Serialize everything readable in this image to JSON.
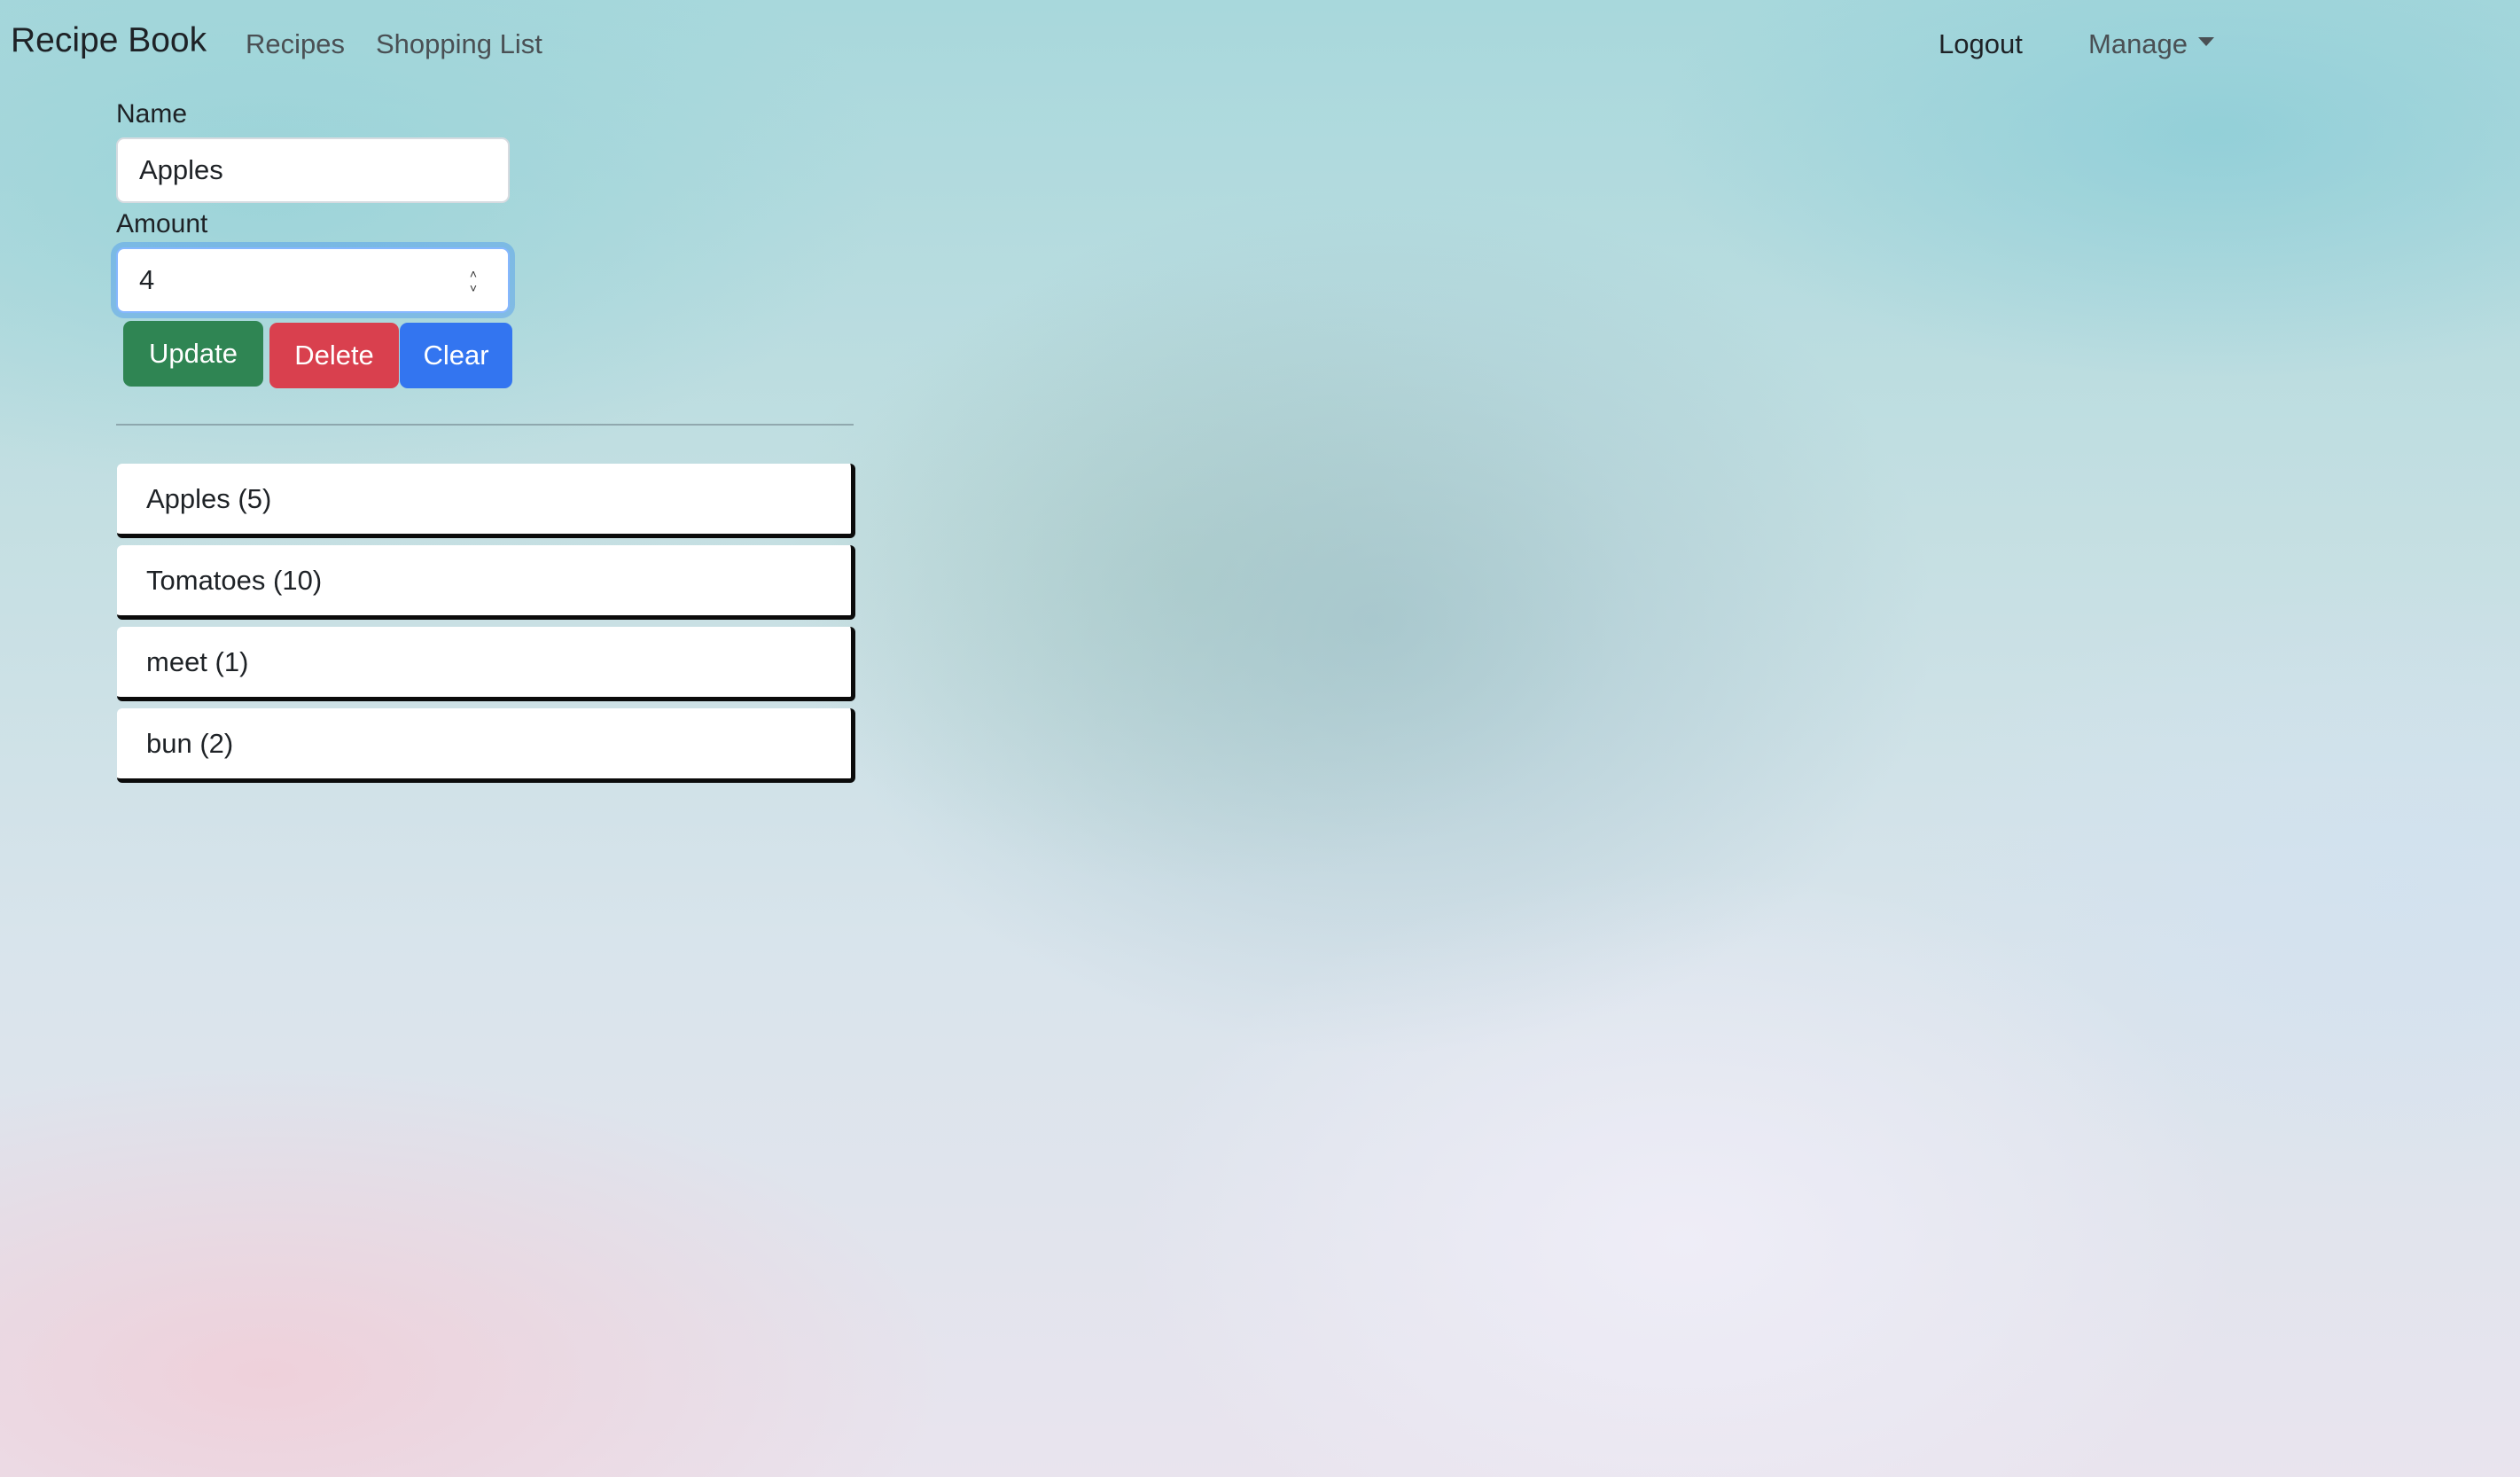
{
  "navbar": {
    "brand": "Recipe Book",
    "links": {
      "recipes": "Recipes",
      "shopping_list": "Shopping List",
      "logout": "Logout",
      "manage": "Manage"
    }
  },
  "form": {
    "name_label": "Name",
    "name_value": "Apples",
    "amount_label": "Amount",
    "amount_value": "4",
    "buttons": {
      "update": "Update",
      "delete": "Delete",
      "clear": "Clear"
    },
    "button_colors": {
      "update": "#2f8553",
      "delete": "#d9404e",
      "clear": "#3375f0"
    }
  },
  "shopping_list": {
    "items": [
      {
        "label": "Apples (5)"
      },
      {
        "label": "Tomatoes (10)"
      },
      {
        "label": "meet (1)"
      },
      {
        "label": "bun (2)"
      }
    ]
  }
}
